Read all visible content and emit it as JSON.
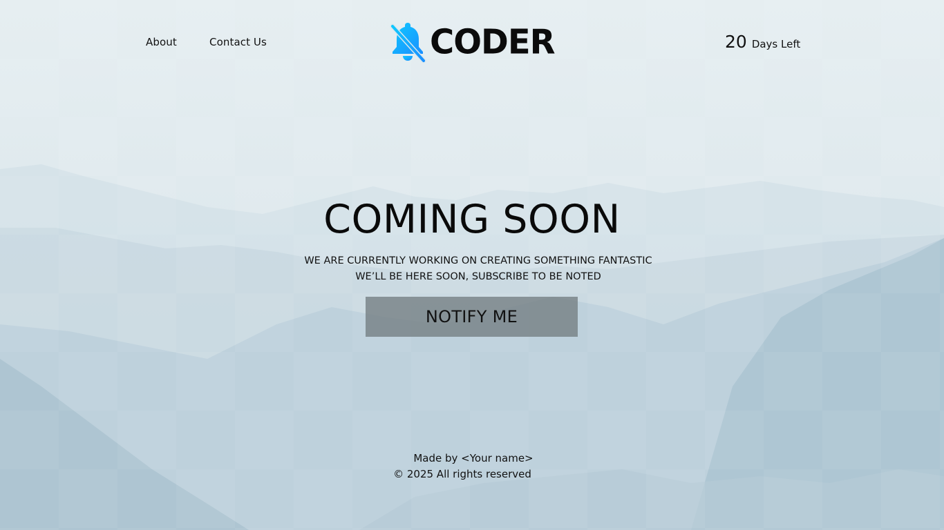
{
  "nav": {
    "about_label": "About",
    "contact_label": "Contact Us"
  },
  "logo": {
    "text": "CODER",
    "icon": "bell-slash-icon",
    "icon_color": "#1ab3ff"
  },
  "countdown": {
    "number": "20",
    "label": "Days Left"
  },
  "hero": {
    "title": "COMING SOON",
    "line1": "WE ARE CURRENTLY WORKING ON CREATING SOMETHING FANTASTIC",
    "line2": "WE’LL BE HERE SOON, SUBSCRIBE TO BE NOTED",
    "button_label": "NOTIFY ME"
  },
  "footer": {
    "made_by": "Made by <Your name>",
    "copyright": "© 2025 All rights reserved"
  }
}
